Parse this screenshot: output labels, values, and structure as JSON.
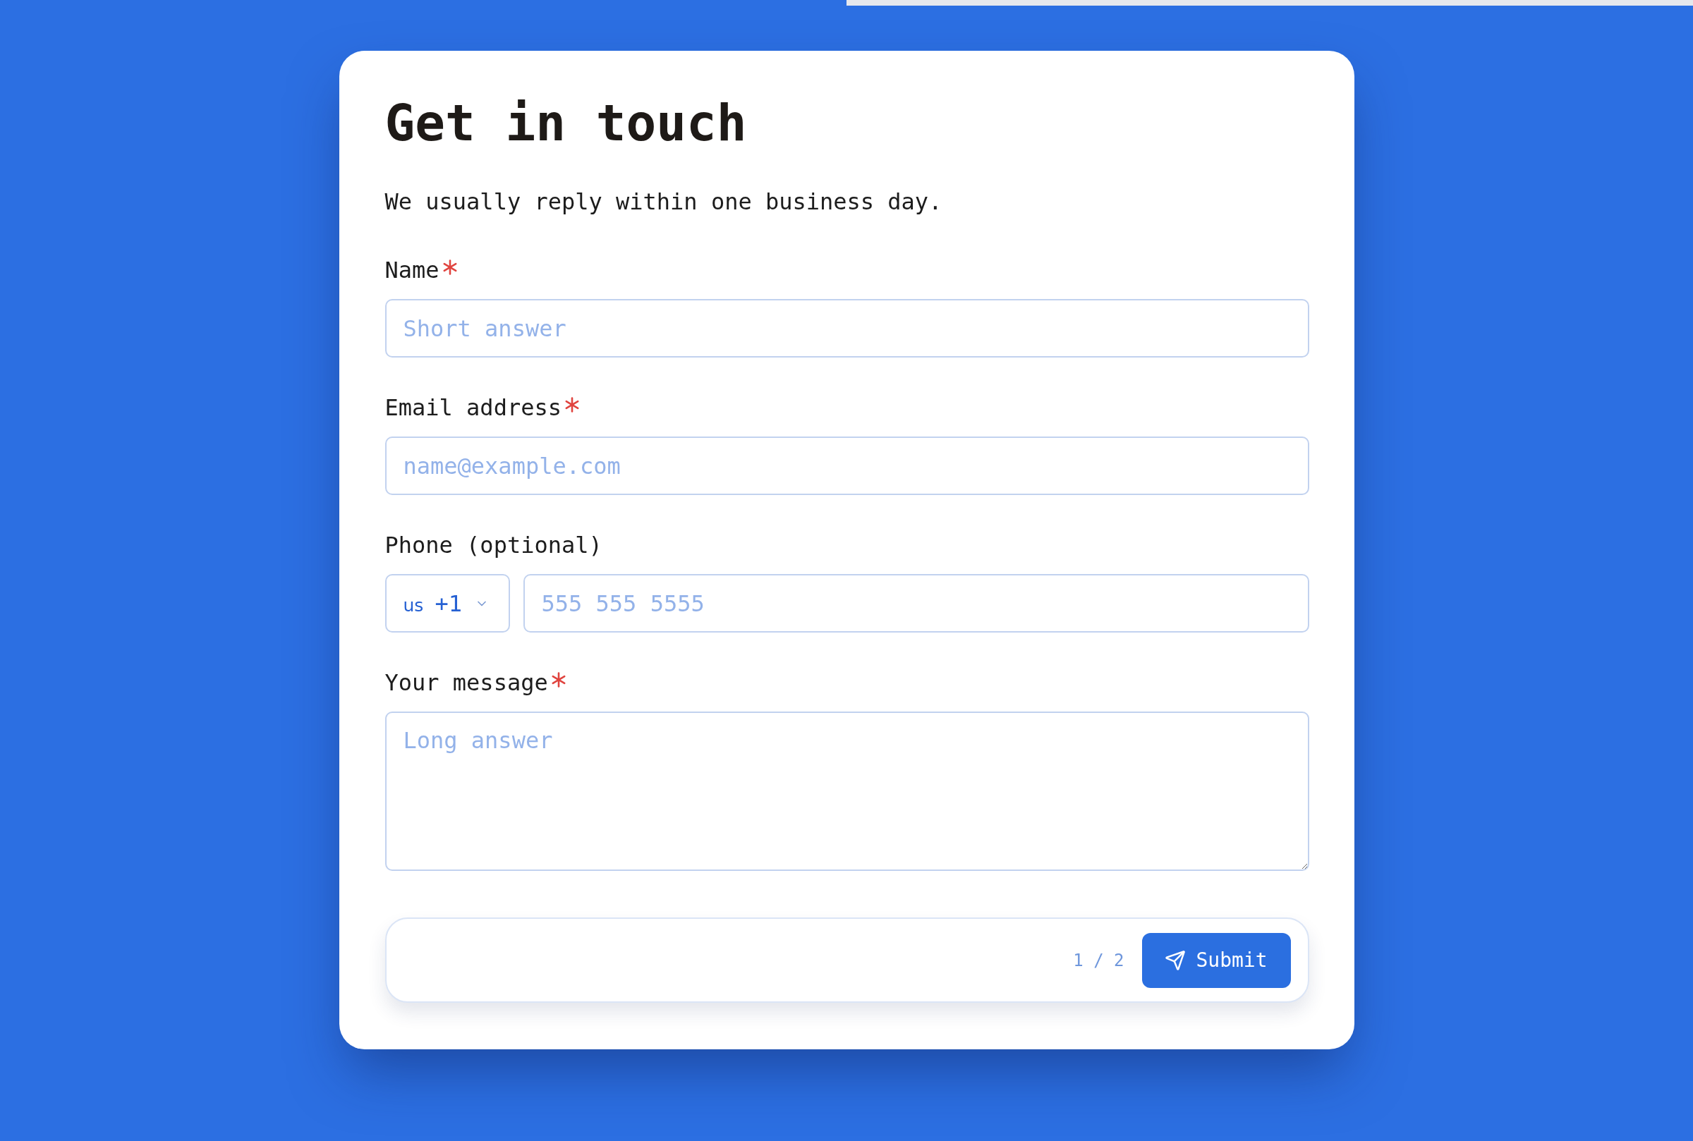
{
  "progress": {
    "level": 0.5
  },
  "form": {
    "title": "Get in touch",
    "subtitle": "We usually reply within one business day.",
    "fields": [
      {
        "kind": "text",
        "label": "Name",
        "required": true,
        "placeholder": "Short answer"
      },
      {
        "kind": "email",
        "label": "Email address",
        "required": true,
        "placeholder": "name@example.com"
      },
      {
        "kind": "phone",
        "label": "Phone (optional)",
        "required": false,
        "country": {
          "code": "us",
          "dial": "+1"
        },
        "placeholder": "555 555 5555"
      },
      {
        "kind": "textarea",
        "label": "Your message",
        "required": true,
        "placeholder": "Long answer"
      }
    ]
  },
  "footer": {
    "page": "1 / 2",
    "submit": "Submit"
  }
}
